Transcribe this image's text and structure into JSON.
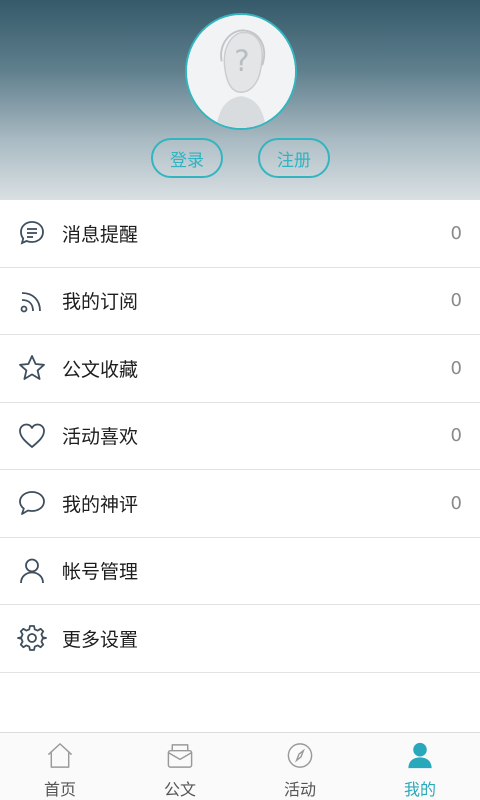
{
  "header": {
    "login_label": "登录",
    "register_label": "注册"
  },
  "menu": [
    {
      "label": "消息提醒",
      "count": "0",
      "icon": "message-icon"
    },
    {
      "label": "我的订阅",
      "count": "0",
      "icon": "rss-icon"
    },
    {
      "label": "公文收藏",
      "count": "0",
      "icon": "star-icon"
    },
    {
      "label": "活动喜欢",
      "count": "0",
      "icon": "heart-icon"
    },
    {
      "label": "我的神评",
      "count": "0",
      "icon": "comment-icon"
    },
    {
      "label": "帐号管理",
      "icon": "user-icon"
    },
    {
      "label": "更多设置",
      "icon": "gear-icon"
    }
  ],
  "tabs": [
    {
      "label": "首页",
      "icon": "home-icon",
      "active": false
    },
    {
      "label": "公文",
      "icon": "envelope-icon",
      "active": false
    },
    {
      "label": "活动",
      "icon": "compass-icon",
      "active": false
    },
    {
      "label": "我的",
      "icon": "profile-icon",
      "active": true
    }
  ],
  "colors": {
    "accent": "#2aa8bb",
    "icon": "#3f4f5e"
  }
}
